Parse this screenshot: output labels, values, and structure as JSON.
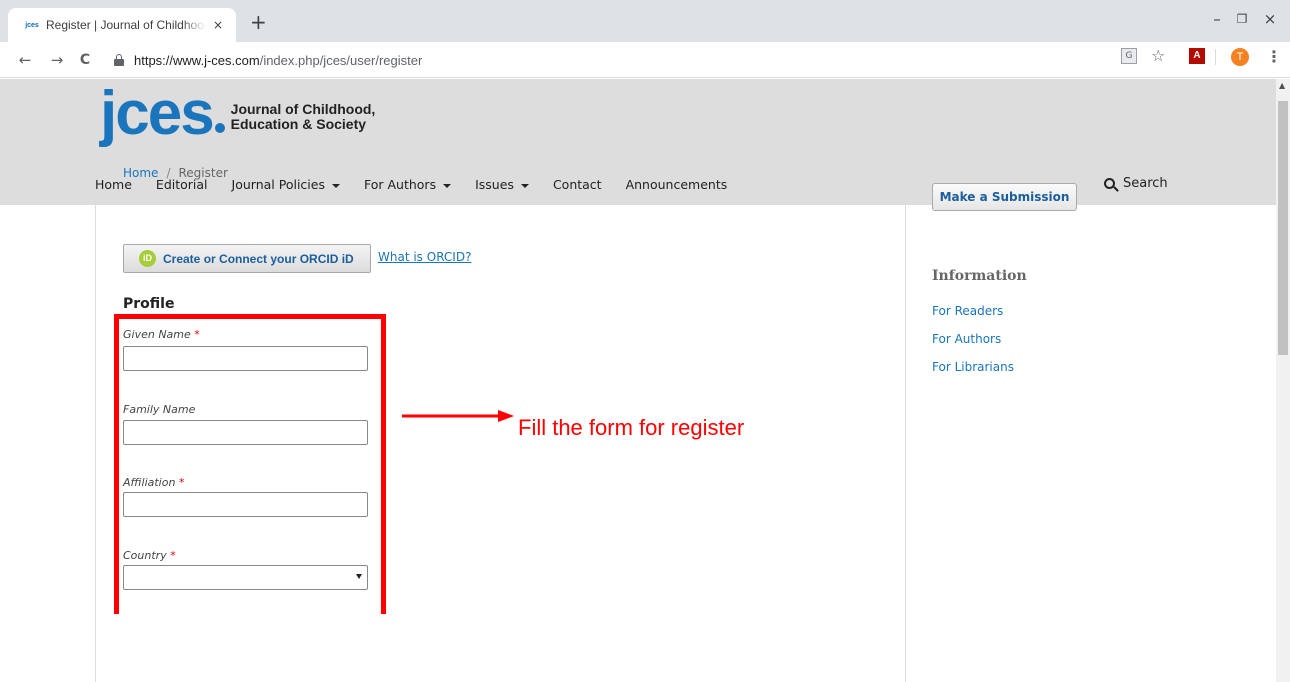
{
  "browser": {
    "tab_title": "Register | Journal of Childhood, E",
    "tab_favicon": "jces",
    "url_host": "https://www.j-ces.com",
    "url_path": "/index.php/jces/user/register",
    "new_tab": "+",
    "tab_close": "×",
    "controls": {
      "minimize": "–",
      "restore": "❐",
      "close": "×"
    },
    "nav": {
      "back": "←",
      "forward": "→",
      "reload": "C"
    },
    "icons": {
      "translate": "translate-icon",
      "bookmark": "star-icon",
      "pdf": "pdf-icon",
      "profile": "avatar",
      "menu": "menu-icon"
    },
    "pdf_glyph": "A",
    "star_glyph": "☆",
    "avatar_letter": "T",
    "menu_glyph": "⋮",
    "translate_glyph": "G"
  },
  "site": {
    "logo_mark": "jces",
    "logo_line1": "Journal of Childhood,",
    "logo_line2": "Education & Society",
    "brand_color": "#1b75bc",
    "nav": [
      {
        "label": "Home",
        "dropdown": false
      },
      {
        "label": "Editorial",
        "dropdown": false
      },
      {
        "label": "Journal Policies",
        "dropdown": true
      },
      {
        "label": "For Authors",
        "dropdown": true
      },
      {
        "label": "Issues",
        "dropdown": true
      },
      {
        "label": "Contact",
        "dropdown": false
      },
      {
        "label": "Announcements",
        "dropdown": false
      }
    ],
    "search_label": "Search"
  },
  "main": {
    "breadcrumb": {
      "home": "Home",
      "separator": "/",
      "current": "Register"
    },
    "orcid_button": "Create or Connect your ORCID iD",
    "orcid_icon": "iD",
    "orcid_link": "What is ORCID?",
    "profile_title": "Profile",
    "fields": [
      {
        "label": "Given Name",
        "required": true,
        "value": "",
        "type": "text"
      },
      {
        "label": "Family Name",
        "required": false,
        "value": "",
        "type": "text"
      },
      {
        "label": "Affiliation",
        "required": true,
        "value": "",
        "type": "text"
      },
      {
        "label": "Country",
        "required": true,
        "value": "",
        "type": "select"
      }
    ],
    "required_mark": "*"
  },
  "annotation": {
    "text": "Fill the form for register",
    "color": "#ff0000"
  },
  "sidebar": {
    "submit_button": "Make a Submission",
    "info_title": "Information",
    "links": [
      "For Readers",
      "For Authors",
      "For Librarians"
    ]
  }
}
